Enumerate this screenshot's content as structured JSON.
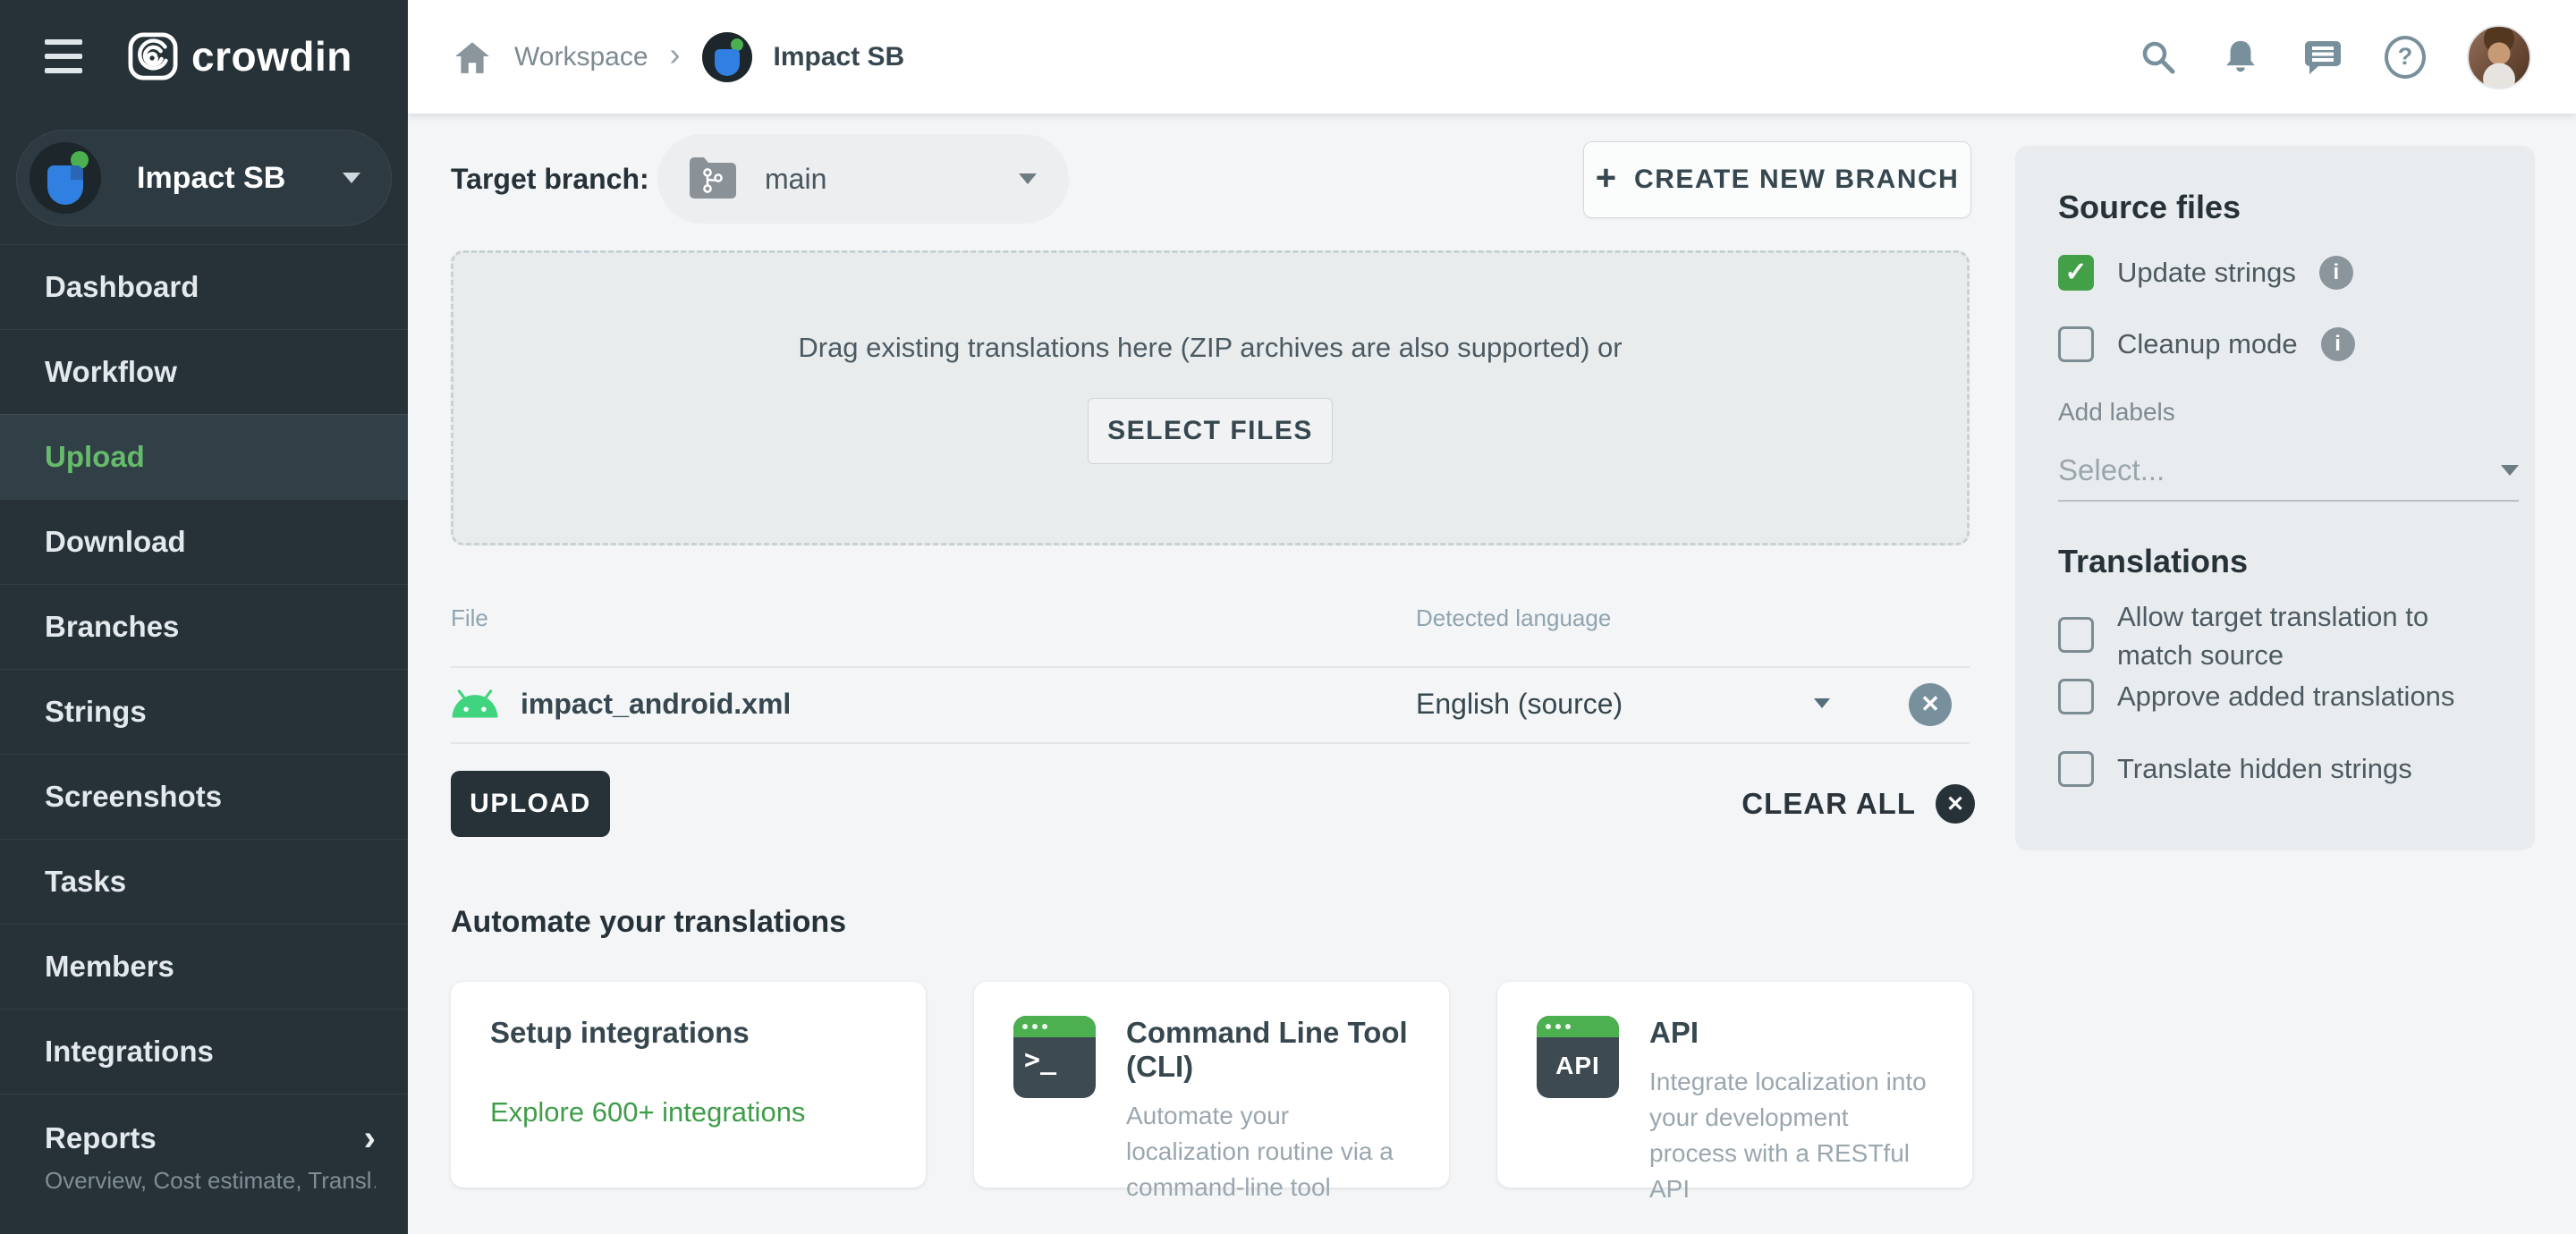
{
  "colors": {
    "sidebar_bg": "#263238",
    "accent_green": "#43a047",
    "nav_active_green": "#66bb6a",
    "link_green": "#3f9d49",
    "android_green": "#3ddc84",
    "icon_gray": "#78909c",
    "dark_button": "#263238"
  },
  "topbar": {
    "breadcrumb": {
      "workspace": "Workspace",
      "project": "Impact SB"
    },
    "icons": [
      "search-icon",
      "notifications-bell-icon",
      "messages-icon",
      "help-icon",
      "user-avatar"
    ],
    "help_glyph": "?"
  },
  "sidebar": {
    "logo_text": "crowdin",
    "project_name": "Impact SB",
    "items": [
      {
        "label": "Dashboard"
      },
      {
        "label": "Workflow"
      },
      {
        "label": "Upload",
        "active": true
      },
      {
        "label": "Download"
      },
      {
        "label": "Branches"
      },
      {
        "label": "Strings"
      },
      {
        "label": "Screenshots"
      },
      {
        "label": "Tasks"
      },
      {
        "label": "Members"
      },
      {
        "label": "Integrations"
      },
      {
        "label": "Reports",
        "subtitle": "Overview, Cost estimate, Transl…",
        "chevron": "›"
      }
    ]
  },
  "main": {
    "target_branch_label": "Target branch:",
    "branch_select_value": "main",
    "create_branch_label": "CREATE NEW BRANCH",
    "create_branch_plus": "+",
    "dropzone_text": "Drag existing translations here (ZIP archives are also supported) or",
    "select_files_label": "SELECT FILES",
    "table": {
      "col_file": "File",
      "col_language": "Detected language",
      "rows": [
        {
          "file": "impact_android.xml",
          "language": "English (source)",
          "file_icon": "android-icon",
          "remove_glyph": "✕"
        }
      ]
    },
    "upload_label": "UPLOAD",
    "clear_all_label": "CLEAR ALL",
    "clear_all_glyph": "✕",
    "automate_title": "Automate your translations",
    "cards": [
      {
        "title": "Setup integrations",
        "link": "Explore 600+ integrations"
      },
      {
        "title": "Command Line Tool (CLI)",
        "desc": "Automate your localization routine via a command-line tool",
        "icon": "terminal-icon",
        "icon_text": ">_"
      },
      {
        "title": "API",
        "desc": "Integrate localization into your development process with a RESTful API",
        "icon": "api-icon",
        "icon_text": "API"
      }
    ]
  },
  "panel": {
    "source_files_title": "Source files",
    "update_strings": {
      "label": "Update strings",
      "checked": true,
      "check_glyph": "✓"
    },
    "cleanup_mode": {
      "label": "Cleanup mode",
      "checked": false
    },
    "info_glyph": "i",
    "add_labels_label": "Add labels",
    "labels_placeholder": "Select...",
    "translations_title": "Translations",
    "allow_match_label": "Allow target translation to match source",
    "approve_added_label": "Approve added translations",
    "translate_hidden_label": "Translate hidden strings"
  }
}
